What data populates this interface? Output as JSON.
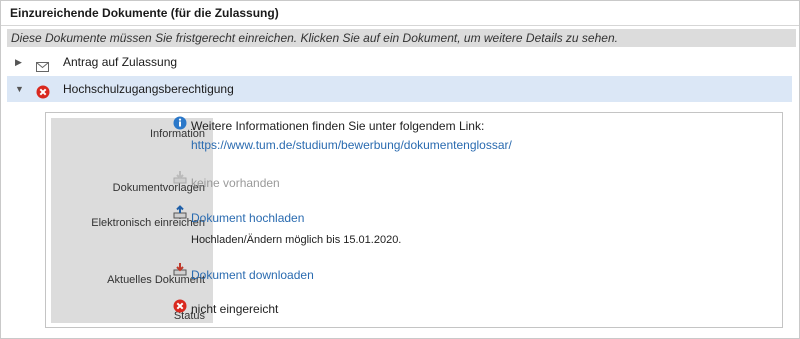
{
  "panel": {
    "title": "Einzureichende Dokumente (für die Zulassung)",
    "hint": "Diese Dokumente müssen Sie fristgerecht einreichen. Klicken Sie auf ein Dokument, um weitere Details zu sehen."
  },
  "documents": [
    {
      "label": "Antrag auf Zulassung",
      "expand_glyph": "▶",
      "icon": "envelope-icon",
      "expanded": false
    },
    {
      "label": "Hochschulzugangsberechtigung",
      "expand_glyph": "▼",
      "icon": "error-icon",
      "expanded": true,
      "status_color": "#d9281e"
    }
  ],
  "detail": {
    "information": {
      "label": "Information",
      "text": "Weitere Informationen finden Sie unter folgendem Link:",
      "link": "https://www.tum.de/studium/bewerbung/dokumentenglossar/",
      "icon": "info-icon"
    },
    "templates": {
      "label": "Dokumentvorlagen",
      "value": "keine vorhanden",
      "icon": "download-disabled-icon"
    },
    "upload": {
      "label": "Elektronisch einreichen",
      "link": "Dokument hochladen",
      "note": "Hochladen/Ändern möglich bis 15.01.2020.",
      "icon": "upload-icon"
    },
    "current": {
      "label": "Aktuelles Dokument",
      "link": "Dokument downloaden",
      "icon": "download-icon"
    },
    "status": {
      "label": "Status",
      "value": "nicht eingereicht",
      "icon": "error-icon"
    }
  },
  "colors": {
    "link": "#2a6bb0",
    "accent_row": "#dbe7f6",
    "label_bg": "#dcdcdc",
    "error": "#d9281e"
  }
}
